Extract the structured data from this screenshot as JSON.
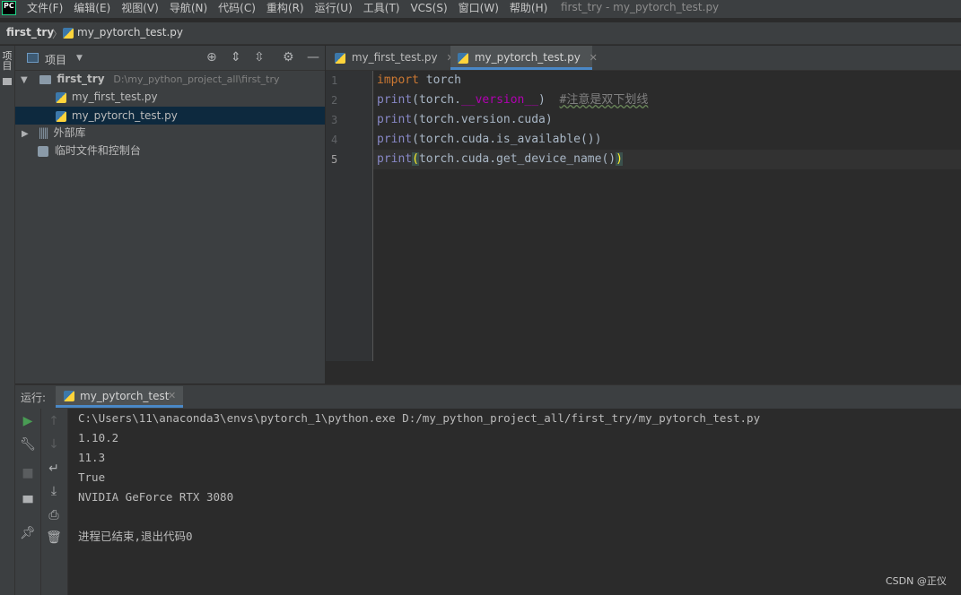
{
  "window": {
    "title": "first_try - my_pytorch_test.py",
    "logo": "PC"
  },
  "menu": [
    "文件(F)",
    "编辑(E)",
    "视图(V)",
    "导航(N)",
    "代码(C)",
    "重构(R)",
    "运行(U)",
    "工具(T)",
    "VCS(S)",
    "窗口(W)",
    "帮助(H)"
  ],
  "breadcrumb": {
    "project": "first_try",
    "separator": "〉",
    "file": "my_pytorch_test.py"
  },
  "left_strip": {
    "label": "项目"
  },
  "project_panel": {
    "title": "项目",
    "tree": {
      "root_name": "first_try",
      "root_path": "D:\\my_python_project_all\\first_try",
      "files": [
        "my_first_test.py",
        "my_pytorch_test.py"
      ],
      "external_libs": "外部库",
      "scratches": "临时文件和控制台"
    }
  },
  "editor": {
    "tabs": [
      {
        "label": "my_first_test.py",
        "active": false
      },
      {
        "label": "my_pytorch_test.py",
        "active": true
      }
    ],
    "line_numbers": [
      "1",
      "2",
      "3",
      "4",
      "5"
    ],
    "code": {
      "l1_kw": "import",
      "l1_rest": " torch",
      "l2_fn": "print",
      "l2_a": "(torch.",
      "l2_magic": "__version__",
      "l2_b": ")  ",
      "l2_comment": "#注意是双下划线",
      "l3_fn": "print",
      "l3_rest": "(torch.version.cuda)",
      "l4_fn": "print",
      "l4_rest": "(torch.cuda.is_available())",
      "l5_fn": "print",
      "l5_open": "(",
      "l5_mid": "torch.cuda.get_device_name()",
      "l5_close": ")"
    }
  },
  "run_panel": {
    "label": "运行:",
    "tab": "my_pytorch_test",
    "output": [
      "C:\\Users\\11\\anaconda3\\envs\\pytorch_1\\python.exe D:/my_python_project_all/first_try/my_pytorch_test.py",
      "1.10.2",
      "11.3",
      "True",
      "NVIDIA GeForce RTX 3080",
      "",
      "进程已结束,退出代码0"
    ]
  },
  "watermark": "CSDN @正仪",
  "colors": {
    "accent": "#4a88c7",
    "keyword": "#cc7832",
    "builtin": "#8888c6",
    "run_green": "#499c54"
  }
}
